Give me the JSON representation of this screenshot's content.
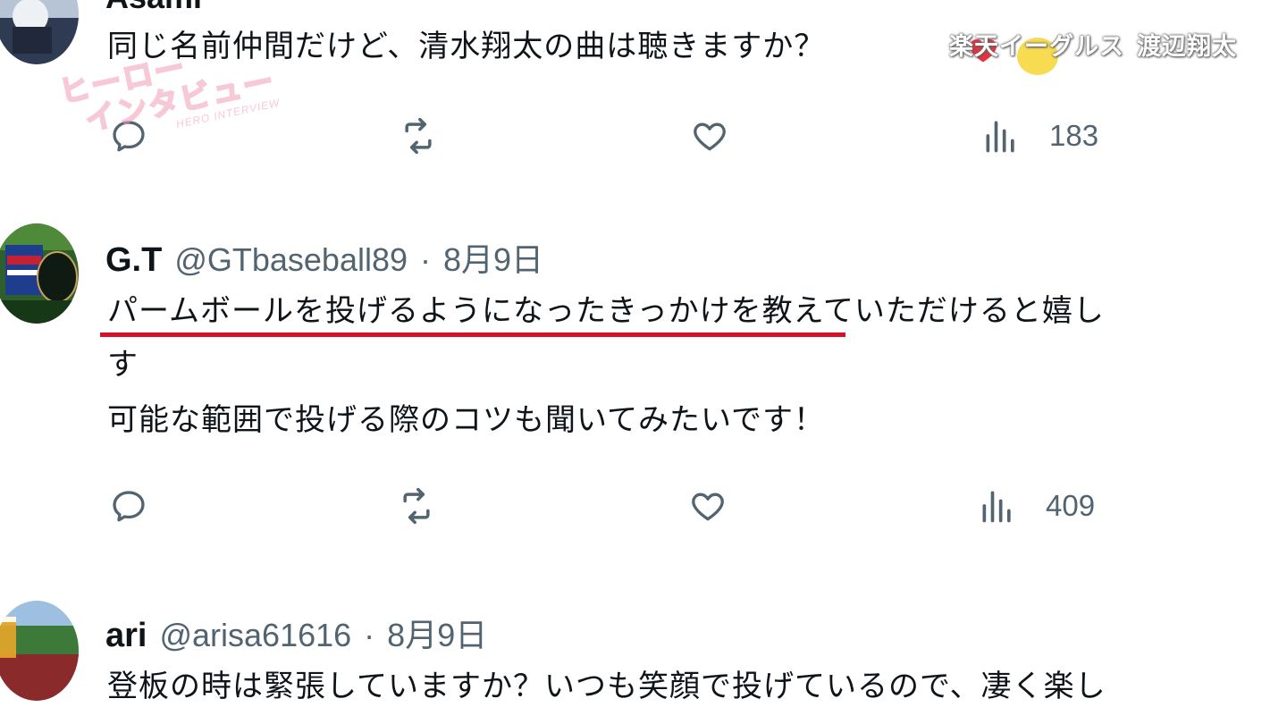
{
  "overlay": {
    "program_logo_line1": "ヒーロー",
    "program_logo_line2": "インタビュー",
    "program_logo_line3": "HERO INTERVIEW",
    "title_team": "楽天イーグルス",
    "title_player": "渡辺翔太"
  },
  "tweets": [
    {
      "display_name": "Asami",
      "handle": "",
      "date": "",
      "lines": [
        "同じ名前仲間だけど、清水翔太の曲は聴きますか？"
      ],
      "views": "183"
    },
    {
      "display_name": "G.T",
      "handle": "@GTbaseball89",
      "dot": "·",
      "date": "8月9日",
      "line1_underlined": "パームボールを投げるようになったきっかけ",
      "line1_rest": "を教えていただけると嬉し",
      "line2": "す",
      "line3": "可能な範囲で投げる際のコツも聞いてみたいです！",
      "views": "409"
    },
    {
      "display_name": "ari",
      "handle": "@arisa61616",
      "dot": "·",
      "date": "8月9日",
      "line1": "登板の時は緊張していますか？いつも笑顔で投げているので、凄く楽し"
    }
  ],
  "icons": {
    "reply": "reply-icon",
    "retweet": "retweet-icon",
    "like": "heart-icon",
    "views": "views-icon"
  },
  "colors": {
    "text": "#0f1419",
    "muted": "#536471",
    "underline": "#d7102a",
    "logo_pink": "#f29cb3"
  }
}
